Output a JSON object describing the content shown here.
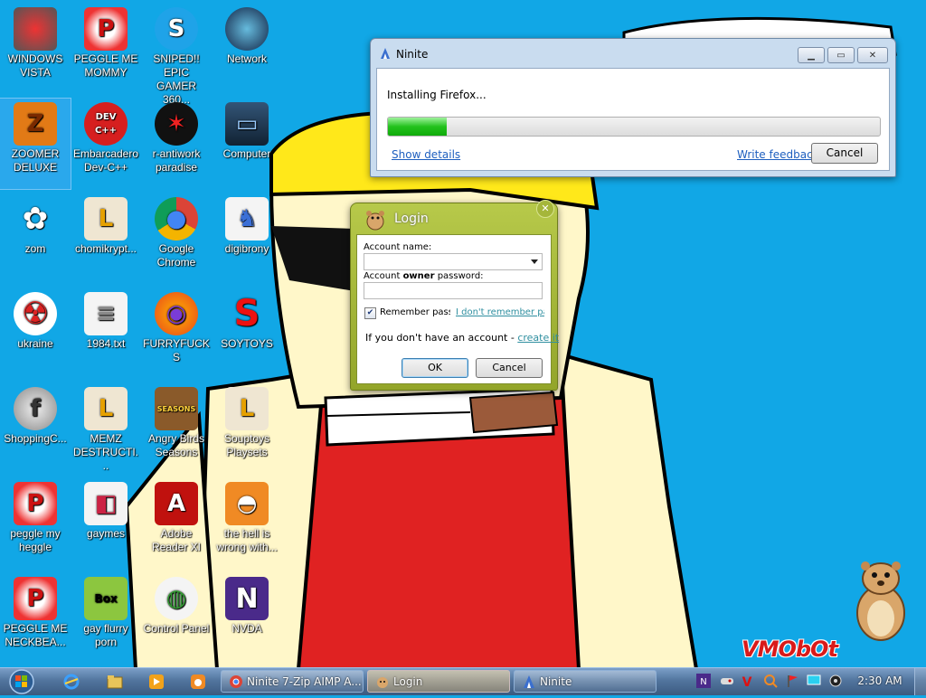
{
  "desktop": {
    "icons": [
      {
        "label": "WINDOWS VISTA",
        "icon": "windows-vista-bowl-icon"
      },
      {
        "label": "PEGGLE ME MOMMY",
        "icon": "peggle-icon"
      },
      {
        "label": "SNIPED!! EPIC GAMER 360...",
        "icon": "skype-icon"
      },
      {
        "label": "Network",
        "icon": "network-globe-icon"
      },
      {
        "label": "ZOOMER DELUXE",
        "icon": "zoomer-icon"
      },
      {
        "label": "Embarcadero Dev-C++",
        "icon": "devcpp-icon"
      },
      {
        "label": "r-antiwork paradise",
        "icon": "antiwork-icon"
      },
      {
        "label": "Computer",
        "icon": "computer-icon"
      },
      {
        "label": "zom",
        "icon": "plant-icon"
      },
      {
        "label": "chomikrypt...",
        "icon": "aimp-icon"
      },
      {
        "label": "Google Chrome",
        "icon": "chrome-icon"
      },
      {
        "label": "digibrony",
        "icon": "digibrony-icon"
      },
      {
        "label": "ukraine",
        "icon": "radiation-icon"
      },
      {
        "label": "1984.txt",
        "icon": "text-file-icon"
      },
      {
        "label": "FURRYFUCKS",
        "icon": "firefox-icon"
      },
      {
        "label": "SOYTOYS",
        "icon": "soytoys-icon"
      },
      {
        "label": "ShoppingC...",
        "icon": "flash-icon"
      },
      {
        "label": "MEMZ DESTRUCTI...",
        "icon": "memz-icon"
      },
      {
        "label": "Angry Birds Seasons",
        "icon": "angry-birds-icon"
      },
      {
        "label": "Souptoys Playsets",
        "icon": "souptoys-icon"
      },
      {
        "label": "peggle my heggle",
        "icon": "peggle-icon"
      },
      {
        "label": "gaymes",
        "icon": "games-folder-icon"
      },
      {
        "label": "Adobe Reader XI",
        "icon": "adobe-reader-icon"
      },
      {
        "label": "the hell is wrong with...",
        "icon": "uc-browser-icon"
      },
      {
        "label": "PEGGLE ME NECKBEA...",
        "icon": "peggle-icon"
      },
      {
        "label": "gay flurry porn",
        "icon": "box-hamster-icon"
      },
      {
        "label": "Control Panel",
        "icon": "control-panel-icon"
      },
      {
        "label": "NVDA",
        "icon": "nvda-icon"
      }
    ],
    "watermark": "VMObOt"
  },
  "ninite": {
    "title": "Ninite",
    "status": "Installing Firefox...",
    "progress": 0.12,
    "show_details": "Show details",
    "write_feedback": "Write feedback",
    "cancel": "Cancel"
  },
  "login": {
    "title": "Login",
    "account_name_label": "Account name:",
    "account_name_value": "",
    "password_label_prefix": "Account ",
    "password_label_bold": "owner",
    "password_label_suffix": " password:",
    "password_value": "",
    "remember_label": "Remember passw",
    "remember_checked": true,
    "forgot_link": "I don't remember pas",
    "no_account_text": "If you don't have an account - ",
    "create_link": "create it",
    "ok": "OK",
    "cancel": "Cancel"
  },
  "taskbar": {
    "buttons": [
      {
        "label": "Ninite 7-Zip AIMP A...",
        "icon": "chrome-icon",
        "active": false
      },
      {
        "label": "Login",
        "icon": "hamster-icon",
        "active": true
      },
      {
        "label": "Ninite",
        "icon": "ninite-icon",
        "active": false
      }
    ],
    "clock": "2:30 AM"
  },
  "colors": {
    "desktop_bg": "#11a7e6",
    "progress_green": "#23c21d",
    "login_frame": "#a7b83a",
    "link_blue": "#1e5fbf",
    "link_teal": "#2f8fa0"
  }
}
